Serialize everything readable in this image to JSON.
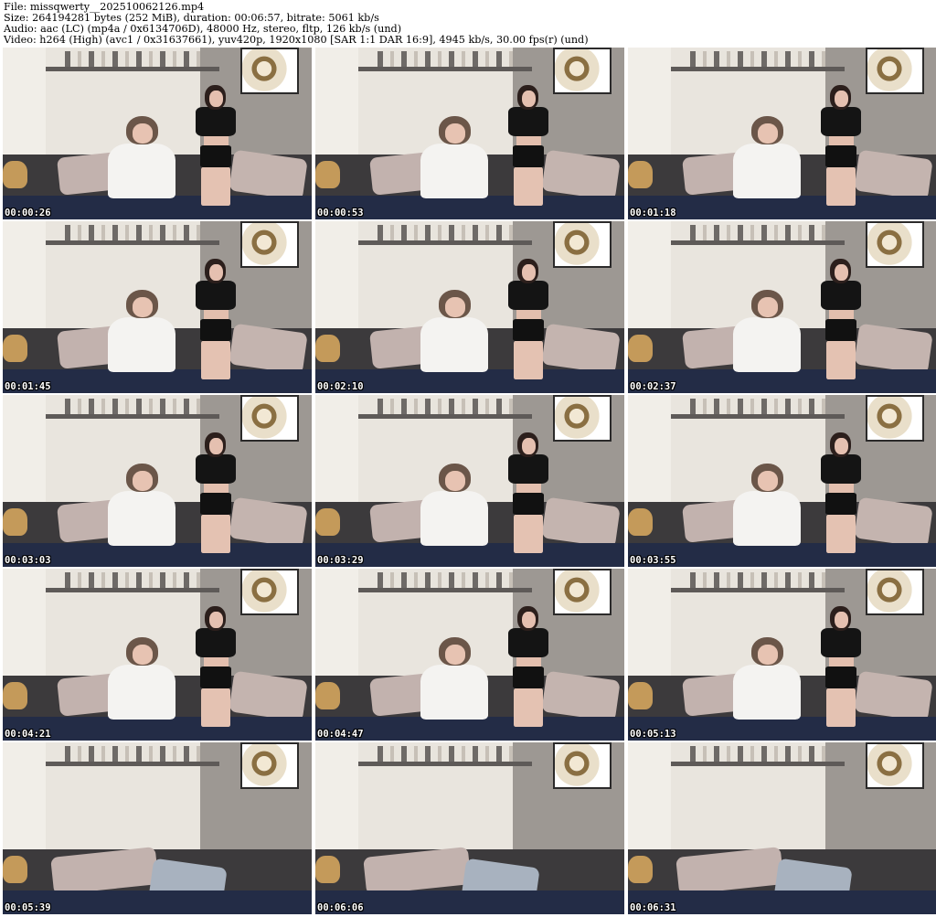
{
  "header": {
    "file_line": "File: missqwerty__202510062126.mp4",
    "size_line": "Size: 264194281 bytes (252 MiB), duration: 00:06:57, bitrate: 5061 kb/s",
    "audio_line": "Audio: aac (LC) (mp4a / 0x6134706D), 48000 Hz, stereo, fltp, 126 kb/s (und)",
    "video_line": "Video: h264 (High) (avc1 / 0x31637661), yuv420p, 1920x1080 [SAR 1:1 DAR 16:9], 4945 kb/s, 30.00 fps(r) (und)"
  },
  "thumbnails": [
    {
      "timestamp": "00:00:26"
    },
    {
      "timestamp": "00:00:53"
    },
    {
      "timestamp": "00:01:18"
    },
    {
      "timestamp": "00:01:45"
    },
    {
      "timestamp": "00:02:10"
    },
    {
      "timestamp": "00:02:37"
    },
    {
      "timestamp": "00:03:03"
    },
    {
      "timestamp": "00:03:29"
    },
    {
      "timestamp": "00:03:55"
    },
    {
      "timestamp": "00:04:21"
    },
    {
      "timestamp": "00:04:47"
    },
    {
      "timestamp": "00:05:13"
    },
    {
      "timestamp": "00:05:39"
    },
    {
      "timestamp": "00:06:06"
    },
    {
      "timestamp": "00:06:31"
    }
  ]
}
